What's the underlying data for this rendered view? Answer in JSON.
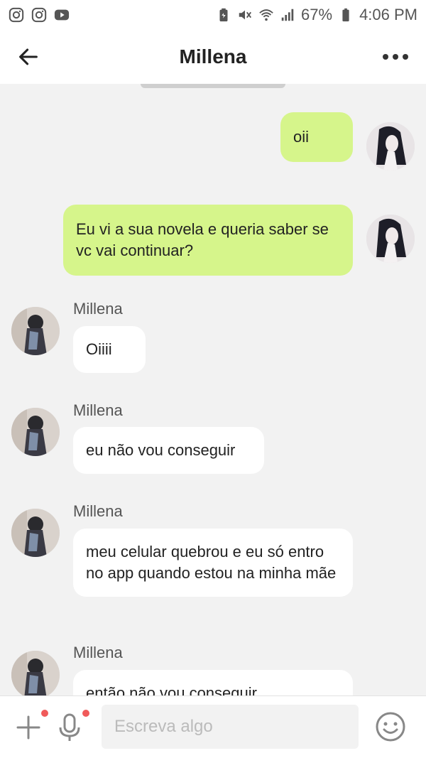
{
  "status_bar": {
    "battery_percent": "67%",
    "time": "4:06 PM",
    "left_icons": [
      "instagram-icon",
      "instagram-icon",
      "youtube-icon"
    ],
    "right_icons": [
      "battery-saver-icon",
      "mute-icon",
      "wifi-icon",
      "signal-icon",
      "battery-icon"
    ]
  },
  "header": {
    "title": "Millena",
    "back_icon": "arrow-left-icon",
    "more_icon": "more-dots-icon"
  },
  "messages": [
    {
      "direction": "out",
      "text": "oii"
    },
    {
      "direction": "out",
      "text": "Eu vi a sua novela e queria saber se vc vai continuar?"
    },
    {
      "direction": "in",
      "sender": "Millena",
      "text": "Oiiii"
    },
    {
      "direction": "in",
      "sender": "Millena",
      "text": "eu não vou conseguir"
    },
    {
      "direction": "in",
      "sender": "Millena",
      "text": "meu celular quebrou e eu só entro no app quando estou na minha mãe"
    },
    {
      "direction": "in",
      "sender": "Millena",
      "text": "então não vou conseguir"
    }
  ],
  "input_bar": {
    "placeholder": "Escreva algo",
    "value": "",
    "plus_icon": "plus-icon",
    "mic_icon": "microphone-icon",
    "emoji_icon": "emoji-icon"
  },
  "colors": {
    "outgoing_bubble": "#d6f58b",
    "incoming_bubble": "#ffffff",
    "background": "#f2f2f2",
    "notification_dot": "#f05a5a"
  }
}
